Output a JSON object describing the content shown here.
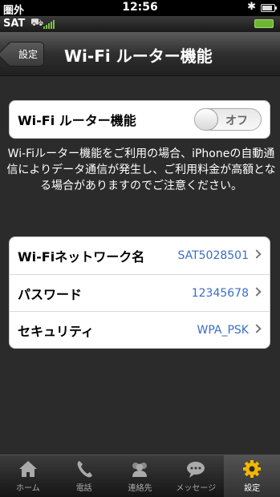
{
  "statusbar": {
    "carrier": "圏外",
    "time": "12:56",
    "bluetooth": "✱"
  },
  "subbar": {
    "sat_label": "SAT"
  },
  "nav": {
    "back_label": "設定",
    "title": "Wi-Fi ルーター機能"
  },
  "router": {
    "label": "Wi-Fi ルーター機能",
    "toggle_text": "オフ",
    "state": "off"
  },
  "notice": "Wi-Fiルーター機能をご利用の場合、iPhoneの自動通信によりデータ通信が発生し、ご利用料金が高額となる場合がありますのでご注意ください。",
  "settings": {
    "rows": [
      {
        "label": "Wi-Fiネットワーク名",
        "value": "SAT5028501"
      },
      {
        "label": "パスワード",
        "value": "12345678"
      },
      {
        "label": "セキュリティ",
        "value": "WPA_PSK"
      }
    ]
  },
  "tabbar": {
    "tabs": [
      {
        "label": "ホーム",
        "icon": "home-icon"
      },
      {
        "label": "電話",
        "icon": "phone-icon"
      },
      {
        "label": "連絡先",
        "icon": "contacts-icon"
      },
      {
        "label": "メッセージ",
        "icon": "message-icon"
      },
      {
        "label": "設定",
        "icon": "gear-icon"
      }
    ],
    "active_index": 4
  },
  "colors": {
    "accent_value": "#3b6cc7",
    "active_gear": "#f2b705"
  }
}
